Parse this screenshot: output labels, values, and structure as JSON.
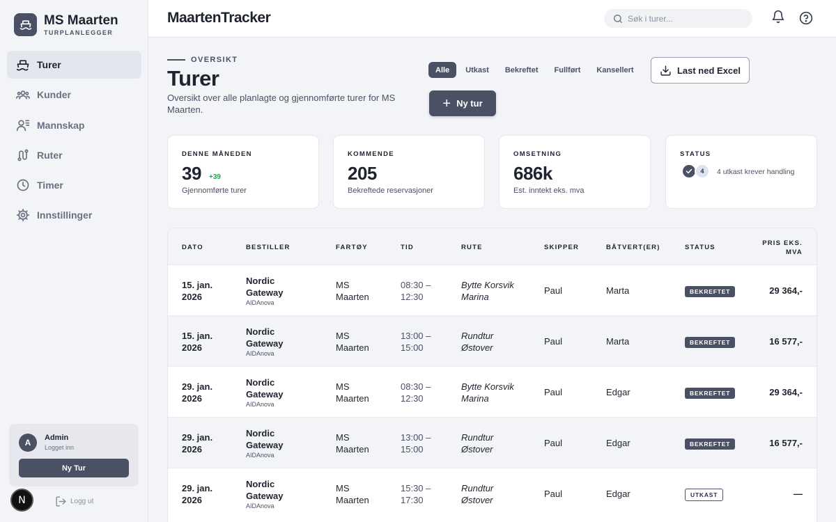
{
  "brand": {
    "name": "MS Maarten",
    "subtitle": "TURPLANLEGGER"
  },
  "nav": [
    {
      "label": "Turer",
      "icon": "ship-icon",
      "active": true
    },
    {
      "label": "Kunder",
      "icon": "users-icon",
      "active": false
    },
    {
      "label": "Mannskap",
      "icon": "crew-icon",
      "active": false
    },
    {
      "label": "Ruter",
      "icon": "route-icon",
      "active": false
    },
    {
      "label": "Timer",
      "icon": "clock-icon",
      "active": false
    },
    {
      "label": "Innstillinger",
      "icon": "gear-icon",
      "active": false
    }
  ],
  "user": {
    "initial": "A",
    "name": "Admin",
    "status": "Logget inn",
    "button": "Ny Tur"
  },
  "footer": {
    "badge": "N",
    "logout": "Logg ut"
  },
  "topbar": {
    "title": "MaartenTracker",
    "search_placeholder": "Søk i turer..."
  },
  "page": {
    "eyebrow": "OVERSIKT",
    "title": "Turer",
    "description": "Oversikt over alle planlagte og gjennomførte turer for MS Maarten."
  },
  "filters": [
    "Alle",
    "Utkast",
    "Bekreftet",
    "Fullført",
    "Kansellert"
  ],
  "active_filter": "Alle",
  "actions": {
    "excel": "Last ned Excel",
    "new_trip": "Ny tur"
  },
  "stats": {
    "month": {
      "label": "DENNE MÅNEDEN",
      "value": "39",
      "delta": "+39",
      "sub": "Gjennomførte turer"
    },
    "upcoming": {
      "label": "KOMMENDE",
      "value": "205",
      "sub": "Bekreftede reservasjoner"
    },
    "revenue": {
      "label": "OMSETNING",
      "value": "686k",
      "sub": "Est. inntekt eks. mva"
    },
    "status": {
      "label": "STATUS",
      "count": "4",
      "text": "4 utkast krever handling"
    }
  },
  "table": {
    "headers": {
      "date": "DATO",
      "client": "BESTILLER",
      "vessel": "FARTØY",
      "time": "TID",
      "route": "RUTE",
      "skipper": "SKIPPER",
      "host": "BÅTVERT(ER)",
      "status": "STATUS",
      "price_1": "PRIS EKS.",
      "price_2": "MVA"
    },
    "rows": [
      {
        "date_1": "15. jan.",
        "date_2": "2026",
        "client_1": "Nordic",
        "client_2": "Gateway",
        "org": "AIDAnova",
        "vessel_1": "MS",
        "vessel_2": "Maarten",
        "time_1": "08:30 –",
        "time_2": "12:30",
        "route_1": "Bytte Korsvik",
        "route_2": "Marina",
        "skipper": "Paul",
        "host": "Marta",
        "status": "BEKREFTET",
        "status_type": "confirmed",
        "price": "29 364,-"
      },
      {
        "date_1": "15. jan.",
        "date_2": "2026",
        "client_1": "Nordic",
        "client_2": "Gateway",
        "org": "AIDAnova",
        "vessel_1": "MS",
        "vessel_2": "Maarten",
        "time_1": "13:00 –",
        "time_2": "15:00",
        "route_1": "Rundtur",
        "route_2": "Østover",
        "skipper": "Paul",
        "host": "Marta",
        "status": "BEKREFTET",
        "status_type": "confirmed",
        "price": "16 577,-"
      },
      {
        "date_1": "29. jan.",
        "date_2": "2026",
        "client_1": "Nordic",
        "client_2": "Gateway",
        "org": "AIDAnova",
        "vessel_1": "MS",
        "vessel_2": "Maarten",
        "time_1": "08:30 –",
        "time_2": "12:30",
        "route_1": "Bytte Korsvik",
        "route_2": "Marina",
        "skipper": "Paul",
        "host": "Edgar",
        "status": "BEKREFTET",
        "status_type": "confirmed",
        "price": "29 364,-"
      },
      {
        "date_1": "29. jan.",
        "date_2": "2026",
        "client_1": "Nordic",
        "client_2": "Gateway",
        "org": "AIDAnova",
        "vessel_1": "MS",
        "vessel_2": "Maarten",
        "time_1": "13:00 –",
        "time_2": "15:00",
        "route_1": "Rundtur",
        "route_2": "Østover",
        "skipper": "Paul",
        "host": "Edgar",
        "status": "BEKREFTET",
        "status_type": "confirmed",
        "price": "16 577,-"
      },
      {
        "date_1": "29. jan.",
        "date_2": "2026",
        "client_1": "Nordic",
        "client_2": "Gateway",
        "org": "AIDAnova",
        "vessel_1": "MS",
        "vessel_2": "Maarten",
        "time_1": "15:30 –",
        "time_2": "17:30",
        "route_1": "Rundtur",
        "route_2": "Østover",
        "skipper": "Paul",
        "host": "Edgar",
        "status": "UTKAST",
        "status_type": "draft",
        "price": "—"
      }
    ]
  }
}
